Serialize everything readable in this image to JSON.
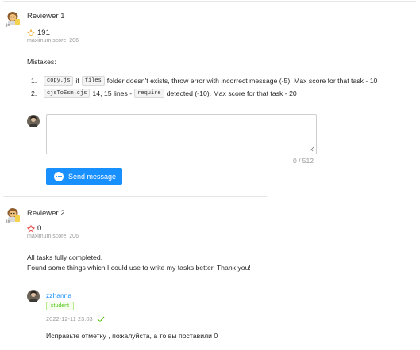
{
  "review1": {
    "reviewer": "Reviewer 1",
    "score": "191",
    "max_score": "maximum score: 206",
    "mistakes_heading": "Mistakes:",
    "mistakes": [
      {
        "num": "1.",
        "code1": "copy.js",
        "t1": "if",
        "code2": "files",
        "t2": "folder doesn't exists, throw error with incorrect message (-5). Max score for that task - 10"
      },
      {
        "num": "2.",
        "code1": "cjsToEsm.cjs",
        "t1": "14, 15 lines -",
        "code2": "require",
        "t2": "detected (-10). Max score for that task - 20"
      }
    ],
    "textarea_value": "",
    "counter": "0 / 512",
    "send_label": "Send message"
  },
  "review2": {
    "reviewer": "Reviewer 2",
    "score": "0",
    "max_score": "maximum score: 206",
    "body_line1": "All tasks fully completed.",
    "body_line2": "Found some things which I could use to write my tasks better. Thank you!",
    "comment": {
      "user": "zzhanna",
      "badge": "student",
      "timestamp": "2022-12-11 23:03",
      "text": "Исправьте отметку , пожалуйста, а то вы поставили 0"
    }
  },
  "colors": {
    "accent": "#1890ff",
    "star_empty": "#e53935",
    "star_outline": "#f5a623",
    "success": "#52c41a"
  }
}
